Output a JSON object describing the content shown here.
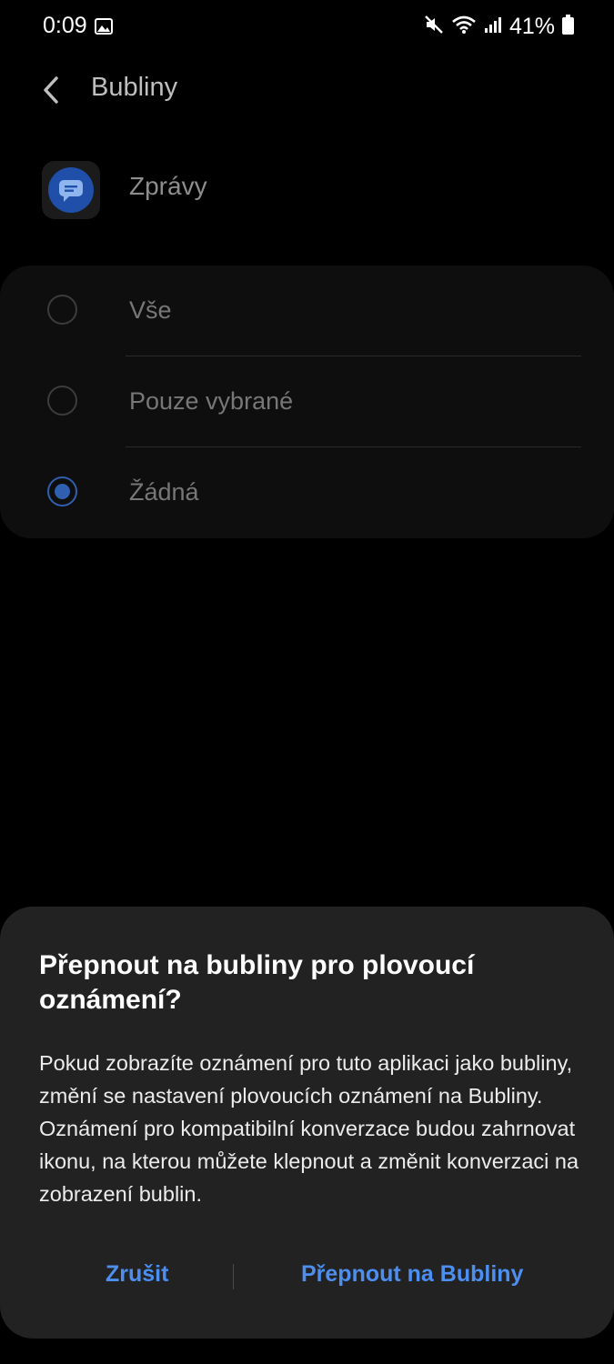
{
  "status_bar": {
    "time": "0:09",
    "battery_percent": "41%",
    "icons": [
      "image-icon",
      "mute-icon",
      "wifi-icon",
      "signal-icon",
      "battery-icon"
    ]
  },
  "header": {
    "title": "Bubliny"
  },
  "app": {
    "name": "Zprávy",
    "icon": "messages-icon",
    "icon_color": "#1f4fa8"
  },
  "options": {
    "items": [
      {
        "label": "Vše",
        "selected": false
      },
      {
        "label": "Pouze vybrané",
        "selected": false
      },
      {
        "label": "Žádná",
        "selected": true
      }
    ]
  },
  "dialog": {
    "title": "Přepnout na bubliny pro plovoucí oznámení?",
    "body": "Pokud zobrazíte oznámení pro tuto aplikaci jako bubliny, změní se nastavení plovoucích oznámení na Bubliny. Oznámení pro kompatibilní konverzace budou zahrnovat ikonu, na kterou můžete klepnout a změnit konverzaci na zobrazení bublin.",
    "cancel_label": "Zrušit",
    "confirm_label": "Přepnout na Bubliny",
    "accent_color": "#4c8ff0"
  }
}
